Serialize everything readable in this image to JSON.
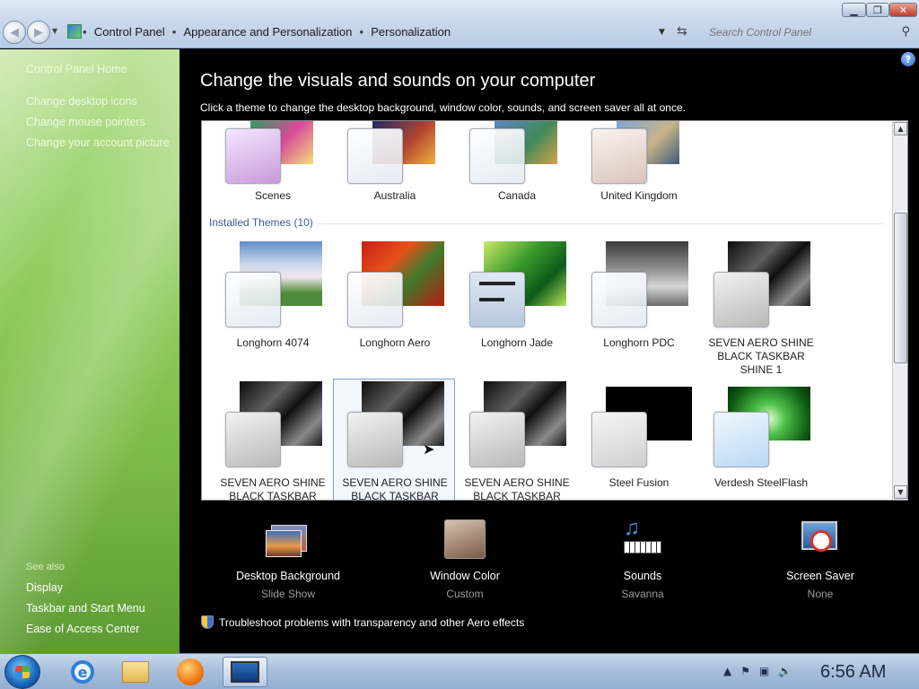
{
  "window": {
    "breadcrumb": [
      "Control Panel",
      "Appearance and Personalization",
      "Personalization"
    ],
    "search_placeholder": "Search Control Panel"
  },
  "left_pane": {
    "home": "Control Panel Home",
    "links": [
      "Change desktop icons",
      "Change mouse pointers",
      "Change your account picture"
    ],
    "see_also_label": "See also",
    "see_also": [
      "Display",
      "Taskbar and Start Menu",
      "Ease of Access Center"
    ]
  },
  "main": {
    "title": "Change the visuals and sounds on your computer",
    "subtitle": "Click a theme to change the desktop background, window color, sounds, and screen saver all at once.",
    "online_themes": [
      {
        "label": "Scenes"
      },
      {
        "label": "Australia"
      },
      {
        "label": "Canada"
      },
      {
        "label": "United Kingdom"
      }
    ],
    "installed_group_label": "Installed Themes (10)",
    "installed_row1": [
      {
        "label": "Longhorn 4074"
      },
      {
        "label": "Longhorn Aero"
      },
      {
        "label": "Longhorn Jade"
      },
      {
        "label": "Longhorn PDC"
      },
      {
        "label": "SEVEN AERO SHINE BLACK TASKBAR SHINE 1"
      }
    ],
    "installed_row2": [
      {
        "label": "SEVEN AERO SHINE BLACK TASKBAR"
      },
      {
        "label": "SEVEN AERO SHINE BLACK TASKBAR"
      },
      {
        "label": "SEVEN AERO SHINE BLACK TASKBAR"
      },
      {
        "label": "Steel Fusion"
      },
      {
        "label": "Verdesh SteelFlash"
      }
    ],
    "customizations": [
      {
        "title": "Desktop Background",
        "value": "Slide Show"
      },
      {
        "title": "Window Color",
        "value": "Custom"
      },
      {
        "title": "Sounds",
        "value": "Savanna"
      },
      {
        "title": "Screen Saver",
        "value": "None"
      }
    ],
    "troubleshoot": "Troubleshoot problems with transparency and other Aero effects"
  },
  "taskbar": {
    "clock": "6:56 AM"
  }
}
